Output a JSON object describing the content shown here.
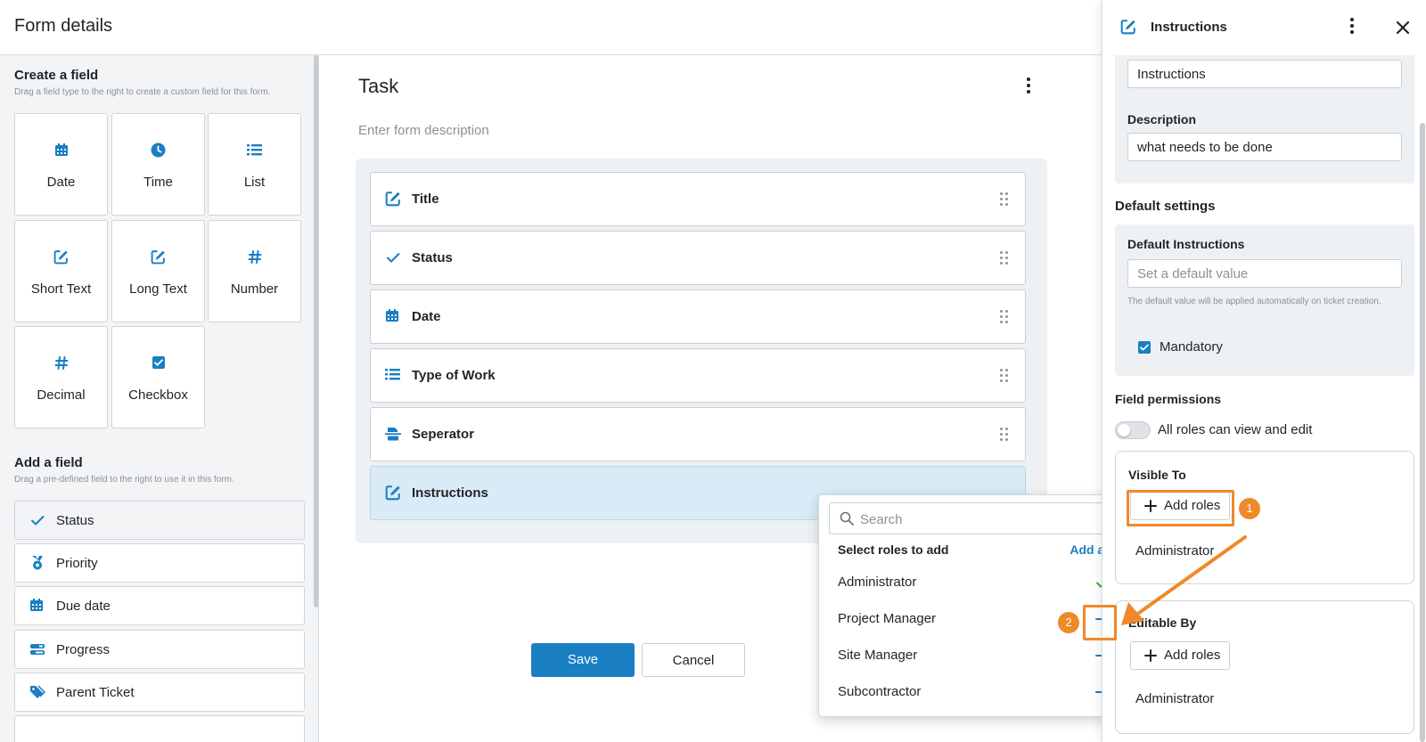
{
  "header": {
    "title": "Form details"
  },
  "left": {
    "create_title": "Create a field",
    "create_sub": "Drag a field type to the right to create a custom field for this form.",
    "tiles": [
      {
        "label": "Date",
        "icon": "calendar-icon"
      },
      {
        "label": "Time",
        "icon": "clock-icon"
      },
      {
        "label": "List",
        "icon": "list-icon"
      },
      {
        "label": "Short Text",
        "icon": "edit-icon"
      },
      {
        "label": "Long Text",
        "icon": "edit-icon"
      },
      {
        "label": "Number",
        "icon": "hash-icon"
      },
      {
        "label": "Decimal",
        "icon": "hash-icon"
      },
      {
        "label": "Checkbox",
        "icon": "checkbox-icon"
      }
    ],
    "add_title": "Add a field",
    "add_sub": "Drag a pre-defined field to the right to use it in this form.",
    "predefined": [
      {
        "label": "Status",
        "icon": "check-icon"
      },
      {
        "label": "Priority",
        "icon": "medal-icon"
      },
      {
        "label": "Due date",
        "icon": "calendar-icon"
      },
      {
        "label": "Progress",
        "icon": "progress-icon"
      },
      {
        "label": "Parent Ticket",
        "icon": "tag-icon"
      }
    ]
  },
  "center": {
    "form_title": "Task",
    "form_description_placeholder": "Enter form description",
    "fields": [
      {
        "label": "Title",
        "icon": "edit-icon"
      },
      {
        "label": "Status",
        "icon": "check-icon"
      },
      {
        "label": "Date",
        "icon": "calendar-icon"
      },
      {
        "label": "Type of Work",
        "icon": "list-icon"
      },
      {
        "label": "Seperator",
        "icon": "separator-icon"
      },
      {
        "label": "Instructions",
        "icon": "edit-icon",
        "selected": true
      }
    ],
    "save_label": "Save",
    "cancel_label": "Cancel"
  },
  "dropdown": {
    "search_placeholder": "Search",
    "heading": "Select roles to add",
    "add_all": "Add all",
    "roles": [
      {
        "label": "Administrator",
        "state": "added"
      },
      {
        "label": "Project Manager",
        "state": "add"
      },
      {
        "label": "Site Manager",
        "state": "add"
      },
      {
        "label": "Subcontractor",
        "state": "add"
      }
    ]
  },
  "right": {
    "title": "Instructions",
    "name_value": "Instructions",
    "description_label": "Description",
    "description_value": "what needs to be done",
    "default_settings": "Default settings",
    "default_label": "Default Instructions",
    "default_placeholder": "Set a default value",
    "default_help": "The default value will be applied automatically on ticket creation.",
    "mandatory_label": "Mandatory",
    "mandatory_checked": true,
    "permissions_title": "Field permissions",
    "all_roles_label": "All roles can view and edit",
    "all_roles_on": false,
    "visible_to": "Visible To",
    "visible_add": "Add roles",
    "visible_role": "Administrator",
    "editable_by": "Editable By",
    "editable_add": "Add roles",
    "editable_role": "Administrator"
  },
  "annotations": {
    "badge1": "1",
    "badge2": "2"
  },
  "colors": {
    "accent": "#1a7ec3",
    "annotation": "#f0892a",
    "check_green": "#3fae3f"
  }
}
